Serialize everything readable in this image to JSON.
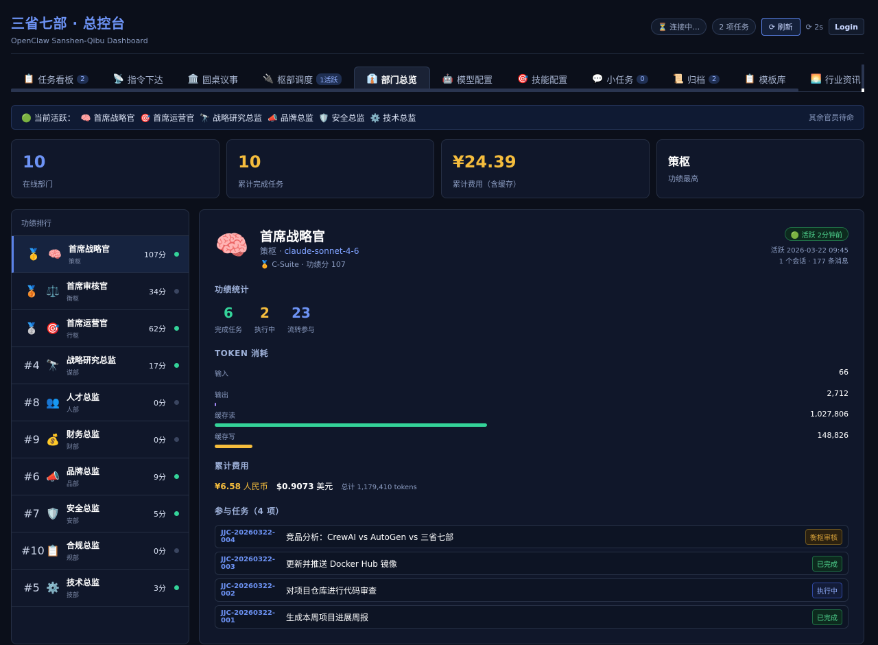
{
  "header": {
    "title": "三省七部 · 总控台",
    "subtitle": "OpenClaw Sanshen-Qibu Dashboard",
    "connecting": "⏳ 连接中…",
    "tasks_chip": "2 项任务",
    "refresh": "⟳ 刷新",
    "interval": "⟳ 2s",
    "login": "Login"
  },
  "tabs": [
    {
      "icon": "📋",
      "label": "任务看板",
      "badge": "2"
    },
    {
      "icon": "📡",
      "label": "指令下达",
      "badge": ""
    },
    {
      "icon": "🏛️",
      "label": "圆桌议事",
      "badge": ""
    },
    {
      "icon": "🔌",
      "label": "枢部调度",
      "badge": "1活跃"
    },
    {
      "icon": "👔",
      "label": "部门总览",
      "badge": ""
    },
    {
      "icon": "🤖",
      "label": "模型配置",
      "badge": ""
    },
    {
      "icon": "🎯",
      "label": "技能配置",
      "badge": ""
    },
    {
      "icon": "💬",
      "label": "小任务",
      "badge": "0"
    },
    {
      "icon": "📜",
      "label": "归档",
      "badge": "2"
    },
    {
      "icon": "📋",
      "label": "模板库",
      "badge": ""
    },
    {
      "icon": "🌅",
      "label": "行业资讯",
      "badge": ""
    }
  ],
  "active_bar": {
    "prefix": "🟢 当前活跃：",
    "items": [
      "🧠 首席战略官",
      "🎯 首席运营官",
      "🔭 战略研究总监",
      "📣 品牌总监",
      "🛡️ 安全总监",
      "⚙️ 技术总监"
    ],
    "right": "其余官员待命"
  },
  "stats": [
    {
      "value": "10",
      "label": "在线部门",
      "color": "#6d93f5"
    },
    {
      "value": "10",
      "label": "累计完成任务",
      "color": "#f5bd3d"
    },
    {
      "value": "¥24.39",
      "label": "累计费用（含缓存）",
      "color": "#f5bd3d"
    },
    {
      "value": "策枢",
      "label": "功绩最高",
      "color": "#ffffff"
    }
  ],
  "ranking": {
    "title": "功绩排行",
    "items": [
      {
        "pos": "🥇",
        "emoji": "🧠",
        "name": "首席战略官",
        "dept": "策枢",
        "score": "107分",
        "active": true
      },
      {
        "pos": "🥉",
        "emoji": "⚖️",
        "name": "首席审核官",
        "dept": "衡枢",
        "score": "34分",
        "active": false
      },
      {
        "pos": "🥈",
        "emoji": "🎯",
        "name": "首席运营官",
        "dept": "行枢",
        "score": "62分",
        "active": true
      },
      {
        "pos": "#4",
        "emoji": "🔭",
        "name": "战略研究总监",
        "dept": "谋部",
        "score": "17分",
        "active": true
      },
      {
        "pos": "#8",
        "emoji": "👥",
        "name": "人才总监",
        "dept": "人部",
        "score": "0分",
        "active": false
      },
      {
        "pos": "#9",
        "emoji": "💰",
        "name": "财务总监",
        "dept": "财部",
        "score": "0分",
        "active": false
      },
      {
        "pos": "#6",
        "emoji": "📣",
        "name": "品牌总监",
        "dept": "品部",
        "score": "9分",
        "active": true
      },
      {
        "pos": "#7",
        "emoji": "🛡️",
        "name": "安全总监",
        "dept": "安部",
        "score": "5分",
        "active": true
      },
      {
        "pos": "#10",
        "emoji": "📋",
        "name": "合规总监",
        "dept": "规部",
        "score": "0分",
        "active": false
      },
      {
        "pos": "#5",
        "emoji": "⚙️",
        "name": "技术总监",
        "dept": "技部",
        "score": "3分",
        "active": true
      }
    ]
  },
  "detail": {
    "avatar": "🧠",
    "name": "首席战略官",
    "dept": "策枢 · ",
    "model": "claude-sonnet-4-6",
    "meta": "🏅 C-Suite · 功绩分 107",
    "status": "🟢 活跃 2分钟前",
    "last_active": "活跃 2026-03-22 09:45",
    "sessions": "1 个会话 · 177 条消息",
    "perf_title": "功绩统计",
    "perf": [
      {
        "value": "6",
        "label": "完成任务",
        "color": "#34d399"
      },
      {
        "value": "2",
        "label": "执行中",
        "color": "#f5bd3d"
      },
      {
        "value": "23",
        "label": "流转参与",
        "color": "#6d93f5"
      }
    ],
    "token_title": "TOKEN 消耗",
    "tokens": [
      {
        "label": "输入",
        "value": "66",
        "fraction": 6e-05,
        "color": "#6d93f5"
      },
      {
        "label": "输出",
        "value": "2,712",
        "fraction": 0.0026,
        "color": "#a78bfa"
      },
      {
        "label": "缓存读",
        "value": "1,027,806",
        "fraction": 0.43,
        "color": "#34d399"
      },
      {
        "label": "缓存写",
        "value": "148,826",
        "fraction": 0.06,
        "color": "#f5bd3d"
      }
    ],
    "cost_title": "累计费用",
    "cost_cny": "¥6.58",
    "cost_cny_unit": "人民币",
    "cost_usd": "$0.9073",
    "cost_usd_unit": "美元",
    "cost_total": "总计 1,179,410 tokens",
    "tasks_title": "参与任务（4 项）",
    "tasks": [
      {
        "id": "JJC-20260322-004",
        "title": "竞品分析：CrewAI vs AutoGen vs 三省七部",
        "tag": "衡枢审核",
        "tag_color": "#d9a33a",
        "tag_bg": "#2b2110",
        "tag_border": "#6b5420"
      },
      {
        "id": "JJC-20260322-003",
        "title": "更新并推送 Docker Hub 镜像",
        "tag": "已完成",
        "tag_color": "#4fd58f",
        "tag_bg": "#0d2a1e",
        "tag_border": "#1f6b45"
      },
      {
        "id": "JJC-20260322-002",
        "title": "对项目仓库进行代码审查",
        "tag": "执行中",
        "tag_color": "#93b0ff",
        "tag_bg": "#131c38",
        "tag_border": "#2f47a0"
      },
      {
        "id": "JJC-20260322-001",
        "title": "生成本周项目进展周报",
        "tag": "已完成",
        "tag_color": "#4fd58f",
        "tag_bg": "#0d2a1e",
        "tag_border": "#1f6b45"
      }
    ]
  }
}
